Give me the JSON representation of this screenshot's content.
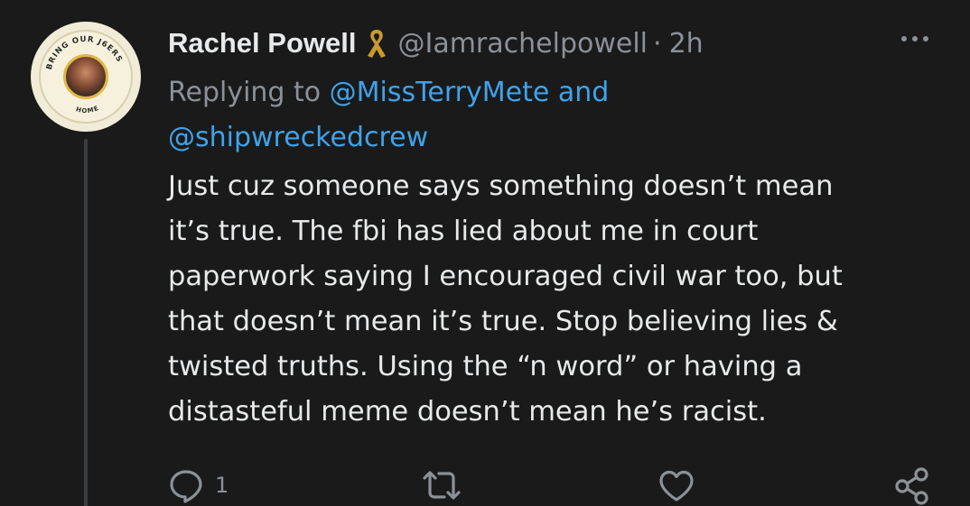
{
  "author": {
    "name": "Rachel Powell",
    "handle": "@Iamrachelpowell",
    "separator": "·",
    "time": "2h"
  },
  "reply": {
    "prefix": "Replying to ",
    "mention_1": "@MissTerryMete",
    "joiner": " and",
    "mention_2": "@shipwreckedcrew"
  },
  "tweet": {
    "lines": [
      "Just cuz someone says something doesn’t mean",
      "it’s true. The fbi has lied about me in court",
      "paperwork saying I encouraged civil war too, but",
      "that doesn’t mean it’s true. Stop believing lies &",
      "twisted truths. Using the “n word” or having a",
      "distasteful meme doesn’t mean he’s racist."
    ]
  },
  "actions": {
    "reply_count": "1"
  },
  "colors": {
    "background": "#1a1a1a",
    "text": "#e7e9ea",
    "muted": "#8b9197",
    "link": "#3fa3ea",
    "ribbon": "#c99a2e"
  }
}
